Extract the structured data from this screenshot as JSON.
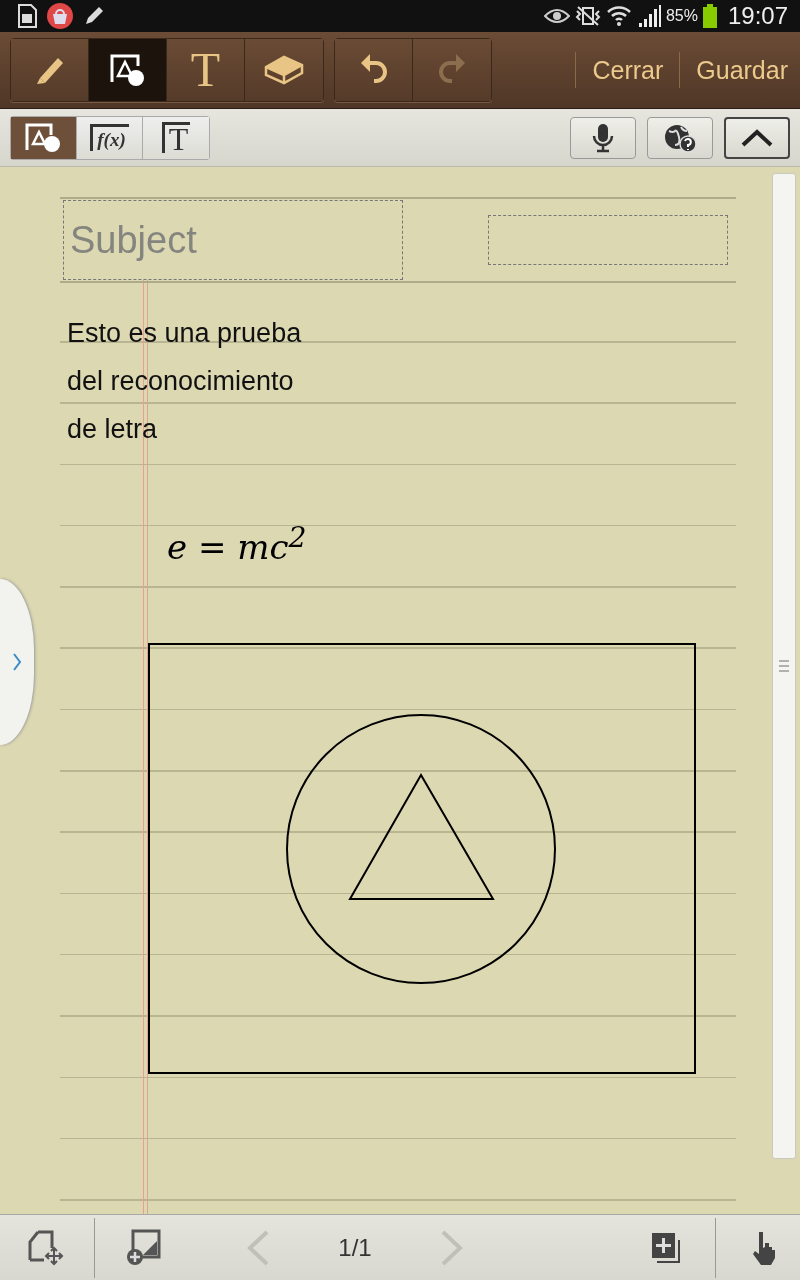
{
  "status_bar": {
    "battery": "85%",
    "time": "19:07"
  },
  "toolbar": {
    "tools": [
      {
        "kind": "pen",
        "selected": false
      },
      {
        "kind": "shape",
        "selected": true
      },
      {
        "kind": "text",
        "glyph": "T",
        "selected": false
      },
      {
        "kind": "eraser",
        "selected": false
      }
    ],
    "history": [
      {
        "kind": "undo",
        "disabled": false
      },
      {
        "kind": "redo",
        "disabled": true
      }
    ],
    "actions": [
      "Cerrar",
      "Guardar"
    ]
  },
  "mode_bar": {
    "modes": [
      {
        "kind": "shape",
        "selected": true
      },
      {
        "kind": "formula",
        "glyph": "f(x)",
        "selected": false
      },
      {
        "kind": "text",
        "glyph": "T",
        "selected": false
      }
    ]
  },
  "note": {
    "subject": {
      "placeholder": "Subject"
    },
    "text_lines": [
      "Esto es una prueba",
      "del reconocimiento",
      "de letra"
    ],
    "formula": "e = mc$^{2}$"
  },
  "pager": {
    "page": "1/1",
    "prev": {
      "disabled": true
    },
    "next": {
      "disabled": true
    }
  }
}
